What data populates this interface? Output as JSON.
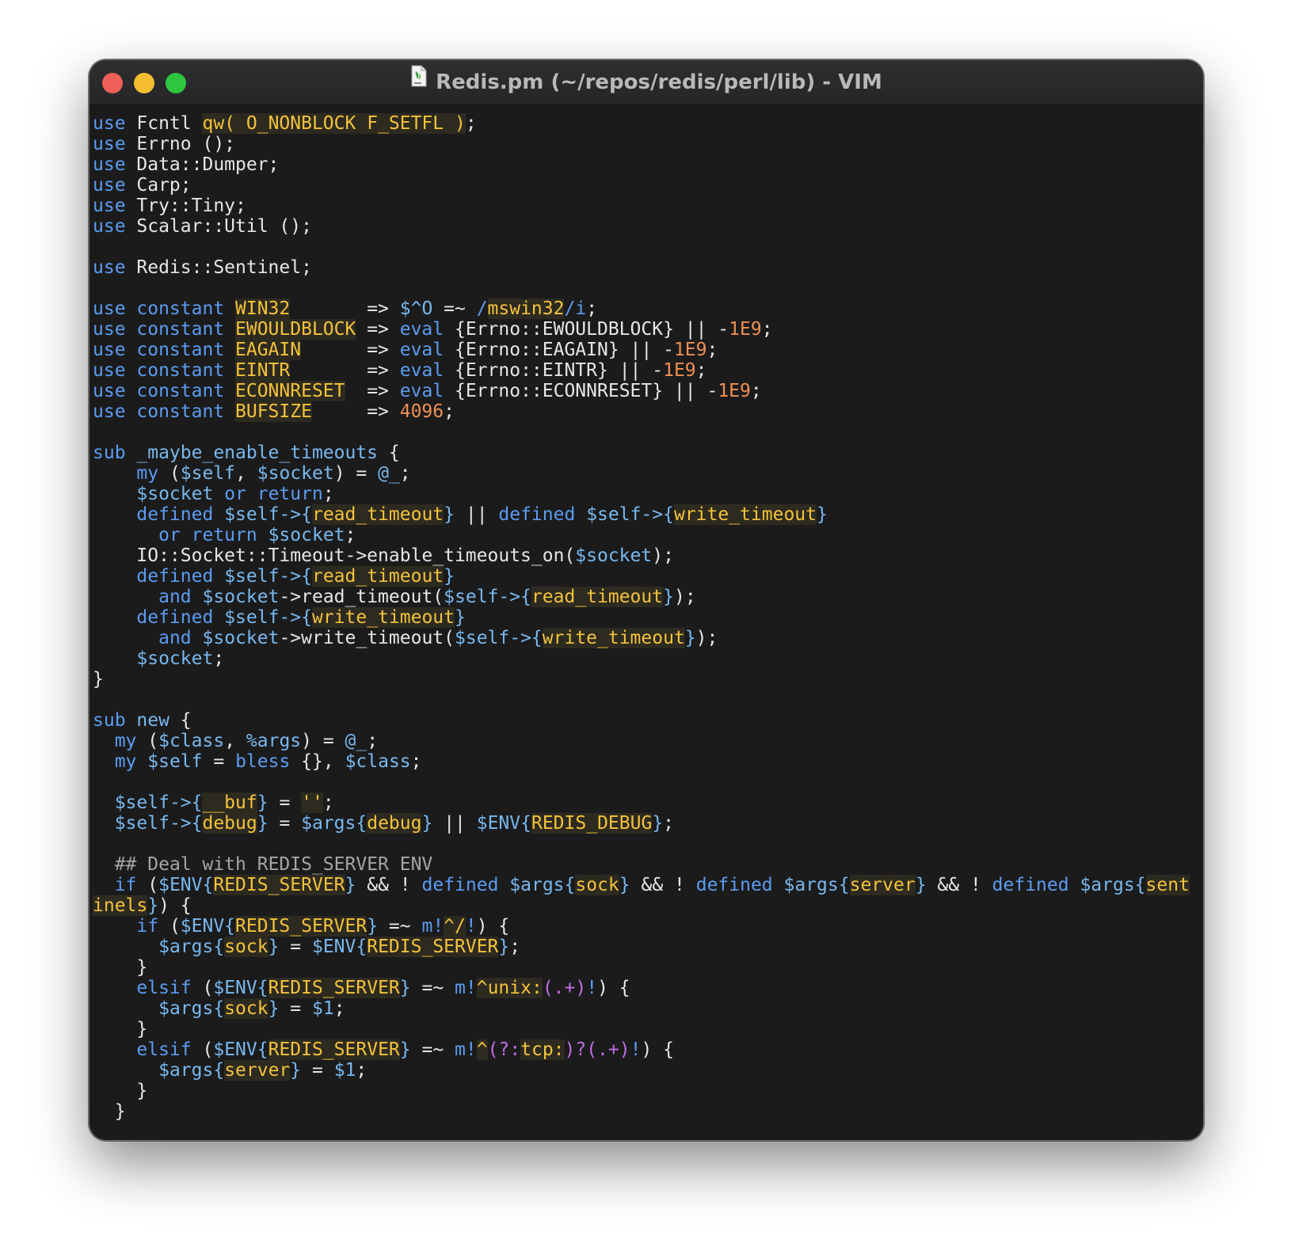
{
  "window": {
    "title": "Redis.pm (~/repos/redis/perl/lib) - VIM",
    "app": "VIM",
    "file_icon": "perl-file-icon"
  },
  "colors": {
    "background": "#1b1b1c",
    "keyword": "#5b9cf0",
    "variable": "#78b8ee",
    "text": "#e6e6e6",
    "string": "#f3c33a",
    "number": "#f09052",
    "comment": "#a5a5a5",
    "regex": "#c06ee4"
  },
  "editor": {
    "lines": [
      [
        {
          "t": "kw",
          "s": "use"
        },
        {
          "t": "txt",
          "s": " Fcntl "
        },
        {
          "t": "str",
          "s": "qw( O_NONBLOCK F_SETFL )"
        },
        {
          "t": "txt",
          "s": ";"
        }
      ],
      [
        {
          "t": "kw",
          "s": "use"
        },
        {
          "t": "txt",
          "s": " Errno ();"
        }
      ],
      [
        {
          "t": "kw",
          "s": "use"
        },
        {
          "t": "txt",
          "s": " Data::Dumper;"
        }
      ],
      [
        {
          "t": "kw",
          "s": "use"
        },
        {
          "t": "txt",
          "s": " Carp;"
        }
      ],
      [
        {
          "t": "kw",
          "s": "use"
        },
        {
          "t": "txt",
          "s": " Try::Tiny;"
        }
      ],
      [
        {
          "t": "kw",
          "s": "use"
        },
        {
          "t": "txt",
          "s": " Scalar::Util ();"
        }
      ],
      [],
      [
        {
          "t": "kw",
          "s": "use"
        },
        {
          "t": "txt",
          "s": " Redis::Sentinel;"
        }
      ],
      [],
      [
        {
          "t": "kw",
          "s": "use constant "
        },
        {
          "t": "str",
          "s": "WIN32"
        },
        {
          "t": "txt",
          "s": "       => "
        },
        {
          "t": "var",
          "s": "$^O"
        },
        {
          "t": "txt",
          "s": " =~ "
        },
        {
          "t": "kw",
          "s": "/"
        },
        {
          "t": "str",
          "s": "mswin32"
        },
        {
          "t": "kw",
          "s": "/i"
        },
        {
          "t": "txt",
          "s": ";"
        }
      ],
      [
        {
          "t": "kw",
          "s": "use constant "
        },
        {
          "t": "str",
          "s": "EWOULDBLOCK"
        },
        {
          "t": "txt",
          "s": " => "
        },
        {
          "t": "kw",
          "s": "eval"
        },
        {
          "t": "txt",
          "s": " {Errno::EWOULDBLOCK} || -"
        },
        {
          "t": "num",
          "s": "1E9"
        },
        {
          "t": "txt",
          "s": ";"
        }
      ],
      [
        {
          "t": "kw",
          "s": "use constant "
        },
        {
          "t": "str",
          "s": "EAGAIN"
        },
        {
          "t": "txt",
          "s": "      => "
        },
        {
          "t": "kw",
          "s": "eval"
        },
        {
          "t": "txt",
          "s": " {Errno::EAGAIN} || -"
        },
        {
          "t": "num",
          "s": "1E9"
        },
        {
          "t": "txt",
          "s": ";"
        }
      ],
      [
        {
          "t": "kw",
          "s": "use constant "
        },
        {
          "t": "str",
          "s": "EINTR"
        },
        {
          "t": "txt",
          "s": "       => "
        },
        {
          "t": "kw",
          "s": "eval"
        },
        {
          "t": "txt",
          "s": " {Errno::EINTR} || -"
        },
        {
          "t": "num",
          "s": "1E9"
        },
        {
          "t": "txt",
          "s": ";"
        }
      ],
      [
        {
          "t": "kw",
          "s": "use constant "
        },
        {
          "t": "str",
          "s": "ECONNRESET"
        },
        {
          "t": "txt",
          "s": "  => "
        },
        {
          "t": "kw",
          "s": "eval"
        },
        {
          "t": "txt",
          "s": " {Errno::ECONNRESET} || -"
        },
        {
          "t": "num",
          "s": "1E9"
        },
        {
          "t": "txt",
          "s": ";"
        }
      ],
      [
        {
          "t": "kw",
          "s": "use constant "
        },
        {
          "t": "str",
          "s": "BUFSIZE"
        },
        {
          "t": "txt",
          "s": "     => "
        },
        {
          "t": "num",
          "s": "4096"
        },
        {
          "t": "txt",
          "s": ";"
        }
      ],
      [],
      [
        {
          "t": "kw",
          "s": "sub "
        },
        {
          "t": "var",
          "s": "_maybe_enable_timeouts"
        },
        {
          "t": "txt",
          "s": " {"
        }
      ],
      [
        {
          "t": "txt",
          "s": "    "
        },
        {
          "t": "kw",
          "s": "my"
        },
        {
          "t": "txt",
          "s": " ("
        },
        {
          "t": "var",
          "s": "$self"
        },
        {
          "t": "txt",
          "s": ", "
        },
        {
          "t": "var",
          "s": "$socket"
        },
        {
          "t": "txt",
          "s": ") = "
        },
        {
          "t": "var",
          "s": "@_"
        },
        {
          "t": "txt",
          "s": ";"
        }
      ],
      [
        {
          "t": "txt",
          "s": "    "
        },
        {
          "t": "var",
          "s": "$socket"
        },
        {
          "t": "txt",
          "s": " "
        },
        {
          "t": "kw",
          "s": "or return"
        },
        {
          "t": "txt",
          "s": ";"
        }
      ],
      [
        {
          "t": "txt",
          "s": "    "
        },
        {
          "t": "kw",
          "s": "defined"
        },
        {
          "t": "txt",
          "s": " "
        },
        {
          "t": "var",
          "s": "$self->{"
        },
        {
          "t": "str",
          "s": "read_timeout"
        },
        {
          "t": "var",
          "s": "}"
        },
        {
          "t": "txt",
          "s": " || "
        },
        {
          "t": "kw",
          "s": "defined"
        },
        {
          "t": "txt",
          "s": " "
        },
        {
          "t": "var",
          "s": "$self->{"
        },
        {
          "t": "str",
          "s": "write_timeout"
        },
        {
          "t": "var",
          "s": "}"
        }
      ],
      [
        {
          "t": "txt",
          "s": "      "
        },
        {
          "t": "kw",
          "s": "or return"
        },
        {
          "t": "txt",
          "s": " "
        },
        {
          "t": "var",
          "s": "$socket"
        },
        {
          "t": "txt",
          "s": ";"
        }
      ],
      [
        {
          "t": "txt",
          "s": "    IO::Socket::Timeout->enable_timeouts_on("
        },
        {
          "t": "var",
          "s": "$socket"
        },
        {
          "t": "txt",
          "s": ");"
        }
      ],
      [
        {
          "t": "txt",
          "s": "    "
        },
        {
          "t": "kw",
          "s": "defined"
        },
        {
          "t": "txt",
          "s": " "
        },
        {
          "t": "var",
          "s": "$self->{"
        },
        {
          "t": "str",
          "s": "read_timeout"
        },
        {
          "t": "var",
          "s": "}"
        }
      ],
      [
        {
          "t": "txt",
          "s": "      "
        },
        {
          "t": "kw",
          "s": "and"
        },
        {
          "t": "txt",
          "s": " "
        },
        {
          "t": "var",
          "s": "$socket"
        },
        {
          "t": "txt",
          "s": "->read_timeout("
        },
        {
          "t": "var",
          "s": "$self->{"
        },
        {
          "t": "str",
          "s": "read_timeout"
        },
        {
          "t": "var",
          "s": "}"
        },
        {
          "t": "txt",
          "s": ");"
        }
      ],
      [
        {
          "t": "txt",
          "s": "    "
        },
        {
          "t": "kw",
          "s": "defined"
        },
        {
          "t": "txt",
          "s": " "
        },
        {
          "t": "var",
          "s": "$self->{"
        },
        {
          "t": "str",
          "s": "write_timeout"
        },
        {
          "t": "var",
          "s": "}"
        }
      ],
      [
        {
          "t": "txt",
          "s": "      "
        },
        {
          "t": "kw",
          "s": "and"
        },
        {
          "t": "txt",
          "s": " "
        },
        {
          "t": "var",
          "s": "$socket"
        },
        {
          "t": "txt",
          "s": "->write_timeout("
        },
        {
          "t": "var",
          "s": "$self->{"
        },
        {
          "t": "str",
          "s": "write_timeout"
        },
        {
          "t": "var",
          "s": "}"
        },
        {
          "t": "txt",
          "s": ");"
        }
      ],
      [
        {
          "t": "txt",
          "s": "    "
        },
        {
          "t": "var",
          "s": "$socket"
        },
        {
          "t": "txt",
          "s": ";"
        }
      ],
      [
        {
          "t": "txt",
          "s": "}"
        }
      ],
      [],
      [
        {
          "t": "kw",
          "s": "sub "
        },
        {
          "t": "var",
          "s": "new"
        },
        {
          "t": "txt",
          "s": " {"
        }
      ],
      [
        {
          "t": "txt",
          "s": "  "
        },
        {
          "t": "kw",
          "s": "my"
        },
        {
          "t": "txt",
          "s": " ("
        },
        {
          "t": "var",
          "s": "$class"
        },
        {
          "t": "txt",
          "s": ", "
        },
        {
          "t": "var",
          "s": "%args"
        },
        {
          "t": "txt",
          "s": ") = "
        },
        {
          "t": "var",
          "s": "@_"
        },
        {
          "t": "txt",
          "s": ";"
        }
      ],
      [
        {
          "t": "txt",
          "s": "  "
        },
        {
          "t": "kw",
          "s": "my"
        },
        {
          "t": "txt",
          "s": " "
        },
        {
          "t": "var",
          "s": "$self"
        },
        {
          "t": "txt",
          "s": " = "
        },
        {
          "t": "kw",
          "s": "bless"
        },
        {
          "t": "txt",
          "s": " {}, "
        },
        {
          "t": "var",
          "s": "$class"
        },
        {
          "t": "txt",
          "s": ";"
        }
      ],
      [],
      [
        {
          "t": "txt",
          "s": "  "
        },
        {
          "t": "var",
          "s": "$self->{"
        },
        {
          "t": "str",
          "s": "__buf"
        },
        {
          "t": "var",
          "s": "}"
        },
        {
          "t": "txt",
          "s": " = "
        },
        {
          "t": "str",
          "s": "''"
        },
        {
          "t": "txt",
          "s": ";"
        }
      ],
      [
        {
          "t": "txt",
          "s": "  "
        },
        {
          "t": "var",
          "s": "$self->{"
        },
        {
          "t": "str",
          "s": "debug"
        },
        {
          "t": "var",
          "s": "}"
        },
        {
          "t": "txt",
          "s": " = "
        },
        {
          "t": "var",
          "s": "$args{"
        },
        {
          "t": "str",
          "s": "debug"
        },
        {
          "t": "var",
          "s": "}"
        },
        {
          "t": "txt",
          "s": " || "
        },
        {
          "t": "var",
          "s": "$ENV{"
        },
        {
          "t": "str",
          "s": "REDIS_DEBUG"
        },
        {
          "t": "var",
          "s": "}"
        },
        {
          "t": "txt",
          "s": ";"
        }
      ],
      [],
      [
        {
          "t": "txt",
          "s": "  "
        },
        {
          "t": "cmt",
          "s": "## Deal with REDIS_SERVER ENV"
        }
      ],
      [
        {
          "t": "txt",
          "s": "  "
        },
        {
          "t": "kw",
          "s": "if"
        },
        {
          "t": "txt",
          "s": " ("
        },
        {
          "t": "var",
          "s": "$ENV{"
        },
        {
          "t": "str",
          "s": "REDIS_SERVER"
        },
        {
          "t": "var",
          "s": "}"
        },
        {
          "t": "txt",
          "s": " && ! "
        },
        {
          "t": "kw",
          "s": "defined"
        },
        {
          "t": "txt",
          "s": " "
        },
        {
          "t": "var",
          "s": "$args{"
        },
        {
          "t": "str",
          "s": "sock"
        },
        {
          "t": "var",
          "s": "}"
        },
        {
          "t": "txt",
          "s": " && ! "
        },
        {
          "t": "kw",
          "s": "defined"
        },
        {
          "t": "txt",
          "s": " "
        },
        {
          "t": "var",
          "s": "$args{"
        },
        {
          "t": "str",
          "s": "server"
        },
        {
          "t": "var",
          "s": "}"
        },
        {
          "t": "txt",
          "s": " && ! "
        },
        {
          "t": "kw",
          "s": "defined"
        },
        {
          "t": "txt",
          "s": " "
        },
        {
          "t": "var",
          "s": "$args{"
        },
        {
          "t": "str",
          "s": "sent"
        }
      ],
      [
        {
          "t": "str",
          "s": "inels"
        },
        {
          "t": "var",
          "s": "}"
        },
        {
          "t": "txt",
          "s": ") {"
        }
      ],
      [
        {
          "t": "txt",
          "s": "    "
        },
        {
          "t": "kw",
          "s": "if"
        },
        {
          "t": "txt",
          "s": " ("
        },
        {
          "t": "var",
          "s": "$ENV{"
        },
        {
          "t": "str",
          "s": "REDIS_SERVER"
        },
        {
          "t": "var",
          "s": "}"
        },
        {
          "t": "txt",
          "s": " =~ "
        },
        {
          "t": "kw",
          "s": "m!"
        },
        {
          "t": "str",
          "s": "^/"
        },
        {
          "t": "kw",
          "s": "!"
        },
        {
          "t": "txt",
          "s": ") {"
        }
      ],
      [
        {
          "t": "txt",
          "s": "      "
        },
        {
          "t": "var",
          "s": "$args{"
        },
        {
          "t": "str",
          "s": "sock"
        },
        {
          "t": "var",
          "s": "}"
        },
        {
          "t": "txt",
          "s": " = "
        },
        {
          "t": "var",
          "s": "$ENV{"
        },
        {
          "t": "str",
          "s": "REDIS_SERVER"
        },
        {
          "t": "var",
          "s": "}"
        },
        {
          "t": "txt",
          "s": ";"
        }
      ],
      [
        {
          "t": "txt",
          "s": "    }"
        }
      ],
      [
        {
          "t": "txt",
          "s": "    "
        },
        {
          "t": "kw",
          "s": "elsif"
        },
        {
          "t": "txt",
          "s": " ("
        },
        {
          "t": "var",
          "s": "$ENV{"
        },
        {
          "t": "str",
          "s": "REDIS_SERVER"
        },
        {
          "t": "var",
          "s": "}"
        },
        {
          "t": "txt",
          "s": " =~ "
        },
        {
          "t": "kw",
          "s": "m!"
        },
        {
          "t": "str",
          "s": "^unix:"
        },
        {
          "t": "re",
          "s": "(.+)"
        },
        {
          "t": "kw",
          "s": "!"
        },
        {
          "t": "txt",
          "s": ") {"
        }
      ],
      [
        {
          "t": "txt",
          "s": "      "
        },
        {
          "t": "var",
          "s": "$args{"
        },
        {
          "t": "str",
          "s": "sock"
        },
        {
          "t": "var",
          "s": "}"
        },
        {
          "t": "txt",
          "s": " = "
        },
        {
          "t": "var",
          "s": "$1"
        },
        {
          "t": "txt",
          "s": ";"
        }
      ],
      [
        {
          "t": "txt",
          "s": "    }"
        }
      ],
      [
        {
          "t": "txt",
          "s": "    "
        },
        {
          "t": "kw",
          "s": "elsif"
        },
        {
          "t": "txt",
          "s": " ("
        },
        {
          "t": "var",
          "s": "$ENV{"
        },
        {
          "t": "str",
          "s": "REDIS_SERVER"
        },
        {
          "t": "var",
          "s": "}"
        },
        {
          "t": "txt",
          "s": " =~ "
        },
        {
          "t": "kw",
          "s": "m!"
        },
        {
          "t": "str",
          "s": "^"
        },
        {
          "t": "re",
          "s": "(?:"
        },
        {
          "t": "str",
          "s": "tcp:"
        },
        {
          "t": "re",
          "s": ")?(.+)"
        },
        {
          "t": "kw",
          "s": "!"
        },
        {
          "t": "txt",
          "s": ") {"
        }
      ],
      [
        {
          "t": "txt",
          "s": "      "
        },
        {
          "t": "var",
          "s": "$args{"
        },
        {
          "t": "str",
          "s": "server"
        },
        {
          "t": "var",
          "s": "}"
        },
        {
          "t": "txt",
          "s": " = "
        },
        {
          "t": "var",
          "s": "$1"
        },
        {
          "t": "txt",
          "s": ";"
        }
      ],
      [
        {
          "t": "txt",
          "s": "    }"
        }
      ],
      [
        {
          "t": "txt",
          "s": "  }"
        }
      ]
    ]
  }
}
